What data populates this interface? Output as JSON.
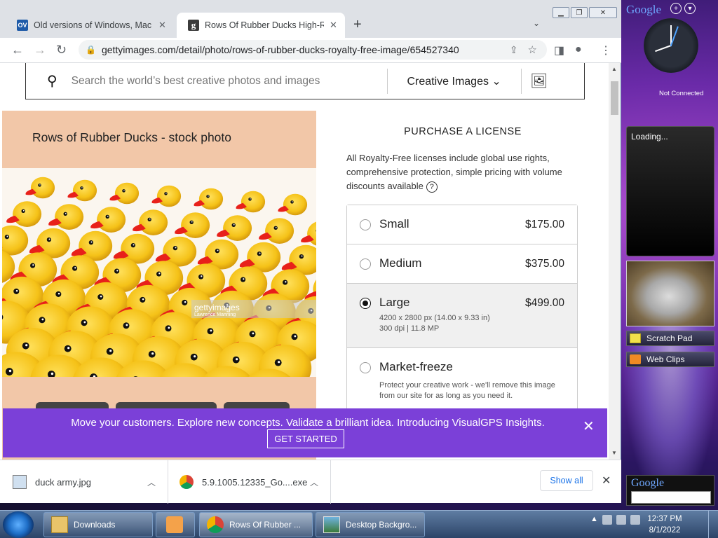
{
  "browser": {
    "tabs": [
      {
        "label": "Old versions of Windows, Mac and",
        "favicon": "OV"
      },
      {
        "label": "Rows Of Rubber Ducks High-Res",
        "favicon": "g"
      }
    ],
    "url": "gettyimages.com/detail/photo/rows-of-rubber-ducks-royalty-free-image/654527340"
  },
  "search": {
    "placeholder": "Search the world’s best creative photos and images",
    "category": "Creative Images"
  },
  "photo": {
    "title": "Rows of Rubber Ducks - stock photo",
    "watermark": "gettyimages",
    "watermark_credit": "Lawrence Manning"
  },
  "license": {
    "heading": "PURCHASE A LICENSE",
    "description": "All Royalty-Free licenses include global use rights, comprehensive protection, simple pricing with volume discounts available",
    "options": [
      {
        "name": "Small",
        "price": "$175.00",
        "selected": false
      },
      {
        "name": "Medium",
        "price": "$375.00",
        "selected": false
      },
      {
        "name": "Large",
        "price": "$499.00",
        "selected": true,
        "dimensions": "4200 x 2800 px (14.00 x 9.33 in)",
        "resolution": "300 dpi | 11.8 MP"
      },
      {
        "name": "Market-freeze",
        "price": "",
        "selected": false,
        "description": "Protect your creative work - we'll remove this image from our site for as long as you need it."
      }
    ]
  },
  "banner": {
    "message": "Move your customers. Explore new concepts. Validate a brilliant idea. Introducing VisualGPS Insights.",
    "cta": "GET STARTED"
  },
  "downloads": {
    "items": [
      {
        "name": "duck army.jpg"
      },
      {
        "name": "5.9.1005.12335_Go....exe"
      }
    ],
    "show_all": "Show all"
  },
  "sidebar": {
    "brand": "Google",
    "clock_status": "Not Connected",
    "feed_status": "Loading...",
    "items": [
      "Scratch Pad",
      "Web Clips"
    ],
    "search_brand": "Google"
  },
  "taskbar": {
    "items": [
      "Downloads",
      "Rows Of Rubber ...",
      "Desktop Backgro..."
    ],
    "time": "12:37 PM",
    "date": "8/1/2022"
  }
}
